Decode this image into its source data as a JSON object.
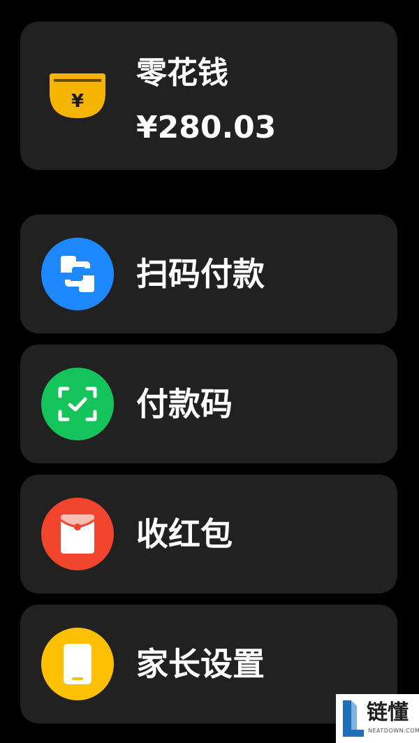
{
  "wallet": {
    "title": "零花钱",
    "amount": "¥280.03",
    "icon": "wallet-yen-icon",
    "icon_color": "#F5B400",
    "icon_symbol": "¥"
  },
  "menu": [
    {
      "label": "扫码付款",
      "icon": "scan-pay-icon",
      "color": "#1E88FF"
    },
    {
      "label": "付款码",
      "icon": "payment-code-icon",
      "color": "#14C35A"
    },
    {
      "label": "收红包",
      "icon": "red-envelope-icon",
      "color": "#F2452E"
    },
    {
      "label": "家长设置",
      "icon": "parent-phone-icon",
      "color": "#FDC002"
    }
  ],
  "watermark": {
    "brand": "链懂",
    "domain": "NEATDOWN.COM"
  }
}
